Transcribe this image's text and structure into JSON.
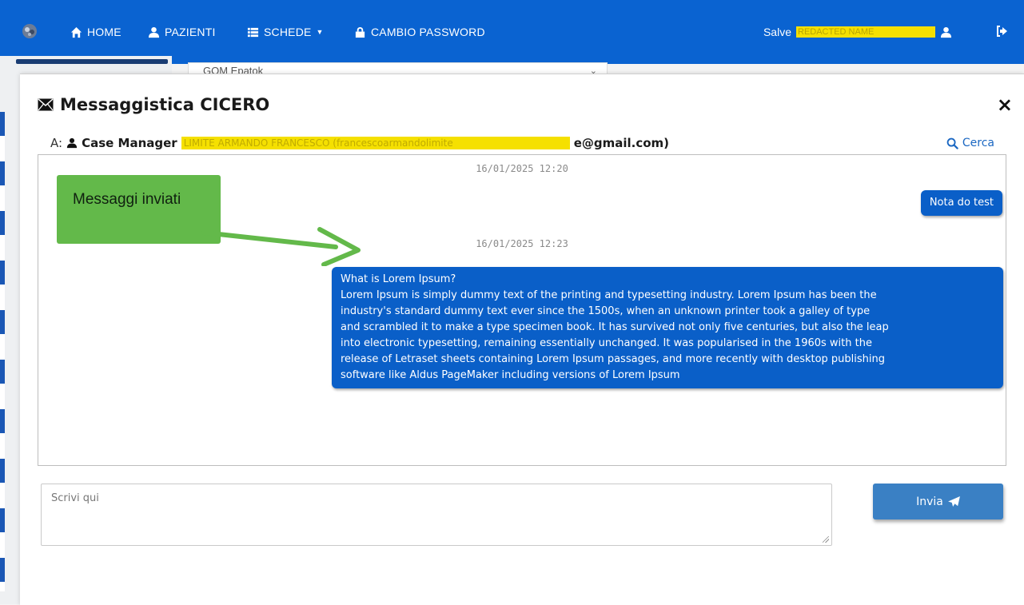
{
  "navbar": {
    "items": [
      {
        "label": "HOME",
        "icon": "home-icon"
      },
      {
        "label": "PAZIENTI",
        "icon": "user-icon"
      },
      {
        "label": "SCHEDE",
        "icon": "list-icon"
      },
      {
        "label": "CAMBIO PASSWORD",
        "icon": "lock-icon"
      }
    ],
    "greeting": "Salve",
    "username_redacted": "REDACTED NAME",
    "colors": {
      "bar": "#0a63d1",
      "redaction": "#f5e000"
    }
  },
  "background": {
    "select_value": "GOM Epatok"
  },
  "modal": {
    "title": "Messaggistica CICERO",
    "close_label": "×",
    "recipient": {
      "prefix": "A:",
      "role": "Case Manager",
      "redacted_text": "LIMITE ARMANDO FRANCESCO (francescoarmandolimite",
      "email_tail": "e@gmail.com)"
    },
    "search_label": "Cerca",
    "messages": [
      {
        "timestamp": "16/01/2025 12:20",
        "text": "Nota do test"
      },
      {
        "timestamp": "16/01/2025 12:23",
        "lines": [
          "What is Lorem Ipsum?",
          "Lorem Ipsum is simply dummy text of the printing and typesetting industry. Lorem Ipsum has been the",
          "industry's standard dummy text ever since the 1500s, when an unknown printer took a galley of type",
          "and scrambled it to make a type specimen book. It has survived not only five centuries, but also the leap",
          "into electronic typesetting, remaining essentially unchanged. It was popularised in the 1960s with the",
          "release of Letraset sheets containing Lorem Ipsum passages, and more recently with desktop publishing",
          "software like Aldus PageMaker including versions of Lorem Ipsum"
        ]
      }
    ],
    "annotation": "Messaggi inviati",
    "compose_placeholder": "Scrivi qui",
    "send_label": "Invia",
    "colors": {
      "bubble": "#0a5fc8",
      "annotation": "#63b94a",
      "send": "#3a80c4",
      "link": "#1a67c2"
    }
  }
}
